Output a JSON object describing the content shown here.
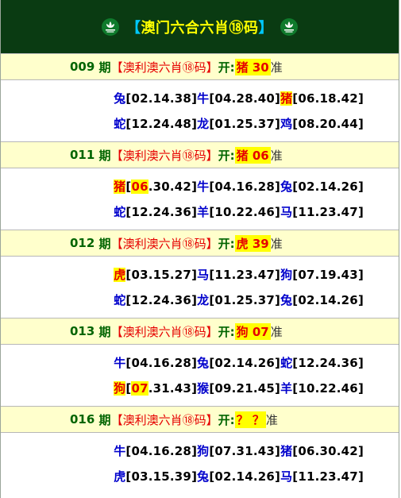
{
  "header": {
    "bracket_left": "【",
    "title": "澳门六合六肖⑱码",
    "bracket_right": "】",
    "left_icon": "macau-lotus-icon",
    "right_icon": "macau-lotus-icon"
  },
  "rows": [
    {
      "issue": "009",
      "label_qi": "期",
      "label_title": "【澳利澳六肖⑱码】",
      "label_open": "开:",
      "result_zodiac": "猪",
      "result_number": "30",
      "label_zhun": "准",
      "lines": [
        [
          {
            "zodiac": "兔",
            "nums": "[02.14.38]"
          },
          {
            "zodiac": "牛",
            "nums": "[04.28.40]"
          },
          {
            "zodiac": "猪",
            "nums": "[06.18.42]",
            "highlight": true
          }
        ],
        [
          {
            "zodiac": "蛇",
            "nums": "[12.24.48]"
          },
          {
            "zodiac": "龙",
            "nums": "[01.25.37]"
          },
          {
            "zodiac": "鸡",
            "nums": "[08.20.44]"
          }
        ]
      ]
    },
    {
      "issue": "011",
      "label_qi": "期",
      "label_title": "【澳利澳六肖⑱码】",
      "label_open": "开:",
      "result_zodiac": "猪",
      "result_number": "06",
      "label_zhun": "准",
      "lines": [
        [
          {
            "zodiac": "猪",
            "nums_pre": "[",
            "nums_hit": "06",
            "nums_post": ".30.42]",
            "highlight": true
          },
          {
            "zodiac": "牛",
            "nums": "[04.16.28]"
          },
          {
            "zodiac": "兔",
            "nums": "[02.14.26]"
          }
        ],
        [
          {
            "zodiac": "蛇",
            "nums": "[12.24.36]"
          },
          {
            "zodiac": "羊",
            "nums": "[10.22.46]"
          },
          {
            "zodiac": "马",
            "nums": "[11.23.47]"
          }
        ]
      ]
    },
    {
      "issue": "012",
      "label_qi": "期",
      "label_title": "【澳利澳六肖⑱码】",
      "label_open": "开:",
      "result_zodiac": "虎",
      "result_number": "39",
      "label_zhun": "准",
      "lines": [
        [
          {
            "zodiac": "虎",
            "nums": "[03.15.27]",
            "highlight": true
          },
          {
            "zodiac": "马",
            "nums": "[11.23.47]"
          },
          {
            "zodiac": "狗",
            "nums": "[07.19.43]"
          }
        ],
        [
          {
            "zodiac": "蛇",
            "nums": "[12.24.36]"
          },
          {
            "zodiac": "龙",
            "nums": "[01.25.37]"
          },
          {
            "zodiac": "兔",
            "nums": "[02.14.26]"
          }
        ]
      ]
    },
    {
      "issue": "013",
      "label_qi": "期",
      "label_title": "【澳利澳六肖⑱码】",
      "label_open": "开:",
      "result_zodiac": "狗",
      "result_number": "07",
      "label_zhun": "准",
      "lines": [
        [
          {
            "zodiac": "牛",
            "nums": "[04.16.28]"
          },
          {
            "zodiac": "兔",
            "nums": "[02.14.26]"
          },
          {
            "zodiac": "蛇",
            "nums": "[12.24.36]"
          }
        ],
        [
          {
            "zodiac": "狗",
            "nums_pre": "[",
            "nums_hit": "07",
            "nums_post": ".31.43]",
            "highlight": true
          },
          {
            "zodiac": "猴",
            "nums": "[09.21.45]"
          },
          {
            "zodiac": "羊",
            "nums": "[10.22.46]"
          }
        ]
      ]
    },
    {
      "issue": "016",
      "label_qi": "期",
      "label_title": "【澳利澳六肖⑱码】",
      "label_open": "开:",
      "result_zodiac": "？",
      "result_number": "？",
      "label_zhun": "准",
      "lines": [
        [
          {
            "zodiac": "牛",
            "nums": "[04.16.28]"
          },
          {
            "zodiac": "狗",
            "nums": "[07.31.43]"
          },
          {
            "zodiac": "猪",
            "nums": "[06.30.42]"
          }
        ],
        [
          {
            "zodiac": "虎",
            "nums": "[03.15.39]"
          },
          {
            "zodiac": "兔",
            "nums": "[02.14.26]"
          },
          {
            "zodiac": "马",
            "nums": "[11.23.47]"
          }
        ]
      ]
    }
  ],
  "colors": {
    "header_bg": "#0a3b12",
    "title": "#ffff00",
    "bracket": "#00c8ff",
    "issue_bg": "#ffffcc",
    "issue_text": "#006400",
    "accent_red": "#e60000",
    "zodiac_blue": "#0000cc",
    "highlight": "#ffff00"
  }
}
